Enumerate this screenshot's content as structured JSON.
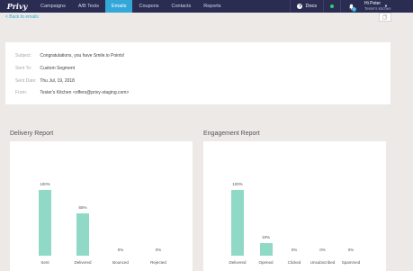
{
  "nav": {
    "logo": "Privy",
    "items": [
      {
        "label": "Campaigns",
        "active": false
      },
      {
        "label": "A/B Tests",
        "active": false
      },
      {
        "label": "Emails",
        "active": true
      },
      {
        "label": "Coupons",
        "active": false
      },
      {
        "label": "Contacts",
        "active": false
      },
      {
        "label": "Reports",
        "active": false
      }
    ],
    "docs_label": "Docs",
    "notification_count": "0",
    "user_name": "Hi Peter",
    "user_company": "Tester's Kitchen"
  },
  "back_link": "< Back to emails",
  "summary": {
    "subject_label": "Subject:",
    "subject_value": "Congratulations, you have Smile.io Points!",
    "sent_to_label": "Sent To:",
    "sent_to_value": "Custom Segment",
    "sent_date_label": "Sent Date:",
    "sent_date_value": "Thu Jul, 19, 2018",
    "from_label": "From:",
    "from_value": "Tester's Kitchen <offers@privy-staging.com>"
  },
  "delivery": {
    "title": "Delivery Report",
    "chart_data": {
      "type": "bar",
      "categories": [
        "Sent",
        "Delivered",
        "Bounced",
        "Rejected"
      ],
      "values": [
        100,
        65,
        0,
        0
      ],
      "value_labels": [
        "100%",
        "65%",
        "0%",
        "0%"
      ],
      "ylim": [
        0,
        100
      ],
      "color": "#8fd9c6"
    }
  },
  "engagement": {
    "title": "Engagement Report",
    "chart_data": {
      "type": "bar",
      "categories": [
        "Delivered",
        "Opened",
        "Clicked",
        "Unsubscribed",
        "Spammed"
      ],
      "values": [
        100,
        19,
        0,
        0,
        0
      ],
      "value_labels": [
        "100%",
        "19%",
        "0%",
        "0%",
        "0%"
      ],
      "ylim": [
        0,
        100
      ],
      "color": "#8fd9c6"
    }
  }
}
